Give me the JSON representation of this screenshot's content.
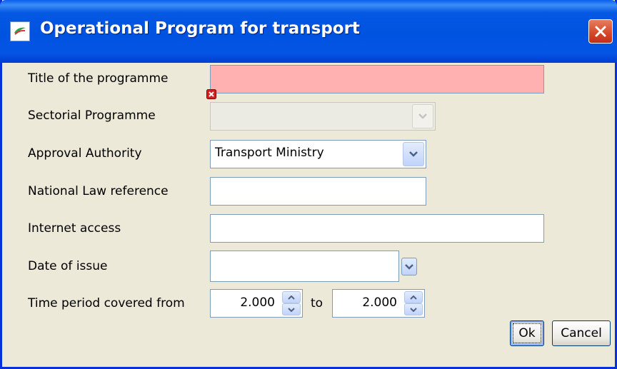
{
  "window": {
    "title": "Operational Program for transport"
  },
  "fields": {
    "title_label": "Title of the programme",
    "title_value": "",
    "sectorial_label": "Sectorial Programme",
    "sectorial_value": "",
    "authority_label": "Approval Authority",
    "authority_value": "Transport Ministry",
    "law_label": "National Law reference",
    "law_value": "",
    "internet_label": "Internet access",
    "internet_value": "",
    "date_label": "Date of issue",
    "date_value": "",
    "period_label": "Time period covered from",
    "period_from": "2.000",
    "period_to_label": "to",
    "period_to": "2.000"
  },
  "buttons": {
    "ok": "Ok",
    "cancel": "Cancel"
  },
  "colors": {
    "error_field": "#ffb0b0",
    "title_bar": "#0053e0",
    "window_bg": "#ece9d8"
  },
  "icons": {
    "app": "app-logo-icon",
    "close": "close-icon",
    "error": "error-x-icon",
    "dropdown": "chevron-down-icon",
    "spin": "spinner-arrows-icon"
  }
}
